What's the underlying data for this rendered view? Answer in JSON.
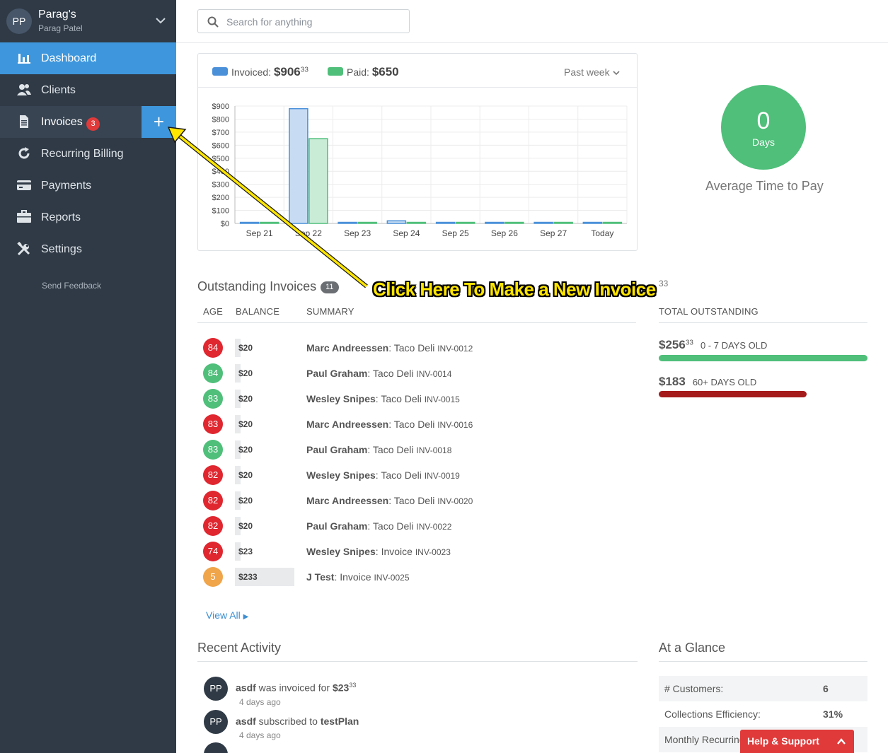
{
  "account": {
    "initials": "PP",
    "name": "Parag's",
    "user": "Parag Patel"
  },
  "nav": {
    "items": [
      {
        "label": "Dashboard",
        "icon": "bar-chart-icon"
      },
      {
        "label": "Clients",
        "icon": "users-icon"
      },
      {
        "label": "Invoices",
        "icon": "document-icon",
        "badge": "3"
      },
      {
        "label": "Recurring Billing",
        "icon": "refresh-icon"
      },
      {
        "label": "Payments",
        "icon": "credit-card-icon"
      },
      {
        "label": "Reports",
        "icon": "briefcase-icon"
      },
      {
        "label": "Settings",
        "icon": "tools-icon"
      }
    ],
    "add_invoice": "+",
    "feedback": "Send Feedback"
  },
  "search": {
    "placeholder": "Search for anything"
  },
  "chart_data": {
    "type": "bar",
    "categories": [
      "Sep 21",
      "Sep 22",
      "Sep 23",
      "Sep 24",
      "Sep 25",
      "Sep 26",
      "Sep 27",
      "Today"
    ],
    "series": [
      {
        "name": "Invoiced",
        "values": [
          0,
          880,
          0,
          20,
          0,
          0,
          0,
          0
        ]
      },
      {
        "name": "Paid",
        "values": [
          0,
          650,
          0,
          0,
          0,
          0,
          0,
          0
        ]
      }
    ],
    "yticks": [
      "$900",
      "$800",
      "$700",
      "$600",
      "$500",
      "$400",
      "$300",
      "$200",
      "$100",
      "$0"
    ],
    "ylim": [
      0,
      900
    ],
    "colors": {
      "invoiced": "#4a90d9",
      "paid": "#4fbf7a"
    },
    "legend": {
      "invoiced_label": "Invoiced:",
      "invoiced_whole": "$906",
      "invoiced_cents": "33",
      "paid_label": "Paid:",
      "paid_amount": "$650"
    },
    "range": "Past week",
    "grid": true
  },
  "avg_time": {
    "value": "0",
    "unit": "Days",
    "label": "Average Time to Pay"
  },
  "outstanding": {
    "title": "Outstanding Invoices",
    "count": "11",
    "headers": {
      "age": "AGE",
      "balance": "BALANCE",
      "summary": "SUMMARY"
    },
    "rows": [
      {
        "age": "84",
        "status": "red",
        "balance": "$20",
        "fill": 0.09,
        "client": "Marc Andreessen",
        "desc": ": Taco Deli ",
        "inv": "INV-0012"
      },
      {
        "age": "84",
        "status": "green",
        "balance": "$20",
        "fill": 0.09,
        "client": "Paul Graham",
        "desc": ": Taco Deli ",
        "inv": "INV-0014"
      },
      {
        "age": "83",
        "status": "green",
        "balance": "$20",
        "fill": 0.09,
        "client": "Wesley Snipes",
        "desc": ": Taco Deli ",
        "inv": "INV-0015"
      },
      {
        "age": "83",
        "status": "red",
        "balance": "$20",
        "fill": 0.09,
        "client": "Marc Andreessen",
        "desc": ": Taco Deli ",
        "inv": "INV-0016"
      },
      {
        "age": "83",
        "status": "green",
        "balance": "$20",
        "fill": 0.09,
        "client": "Paul Graham",
        "desc": ": Taco Deli ",
        "inv": "INV-0018"
      },
      {
        "age": "82",
        "status": "red",
        "balance": "$20",
        "fill": 0.09,
        "client": "Wesley Snipes",
        "desc": ": Taco Deli ",
        "inv": "INV-0019"
      },
      {
        "age": "82",
        "status": "red",
        "balance": "$20",
        "fill": 0.09,
        "client": "Marc Andreessen",
        "desc": ": Taco Deli ",
        "inv": "INV-0020"
      },
      {
        "age": "82",
        "status": "red",
        "balance": "$20",
        "fill": 0.09,
        "client": "Paul Graham",
        "desc": ": Taco Deli ",
        "inv": "INV-0022"
      },
      {
        "age": "74",
        "status": "red",
        "balance": "$23",
        "fill": 0.1,
        "client": "Wesley Snipes",
        "desc": ": Invoice ",
        "inv": "INV-0023"
      },
      {
        "age": "5",
        "status": "orange",
        "balance": "$233",
        "fill": 1.0,
        "client": "J Test",
        "desc": ": Invoice ",
        "inv": "INV-0025"
      }
    ],
    "view_all": "View All"
  },
  "totals": {
    "big_cents": "33",
    "header": "TOTAL OUTSTANDING",
    "recent": {
      "amount": "$256",
      "cents": "33",
      "label": "0 - 7 DAYS OLD",
      "fill": 1.0
    },
    "old": {
      "amount": "$183",
      "label": "60+ DAYS OLD",
      "fill": 0.71
    }
  },
  "status_colors": {
    "red": "#e0262f",
    "green": "#4fbf7a",
    "orange": "#f0a54a"
  },
  "callout": "Click Here To Make a New Invoice",
  "activity": {
    "title": "Recent Activity",
    "items": [
      {
        "initials": "PP",
        "who": "asdf",
        "text": " was invoiced for ",
        "amount": "$23",
        "cents": "33",
        "time": "4 days ago"
      },
      {
        "initials": "PP",
        "who": "asdf",
        "text": " subscribed to ",
        "plan": "testPlan",
        "time": "4 days ago"
      }
    ]
  },
  "glance": {
    "title": "At a Glance",
    "rows": [
      {
        "key": "# Customers:",
        "value": "6"
      },
      {
        "key": "Collections Efficiency:",
        "value": "31%"
      },
      {
        "key": "Monthly Recurring",
        "value": ""
      }
    ]
  },
  "help": {
    "label": "Help & Support"
  }
}
